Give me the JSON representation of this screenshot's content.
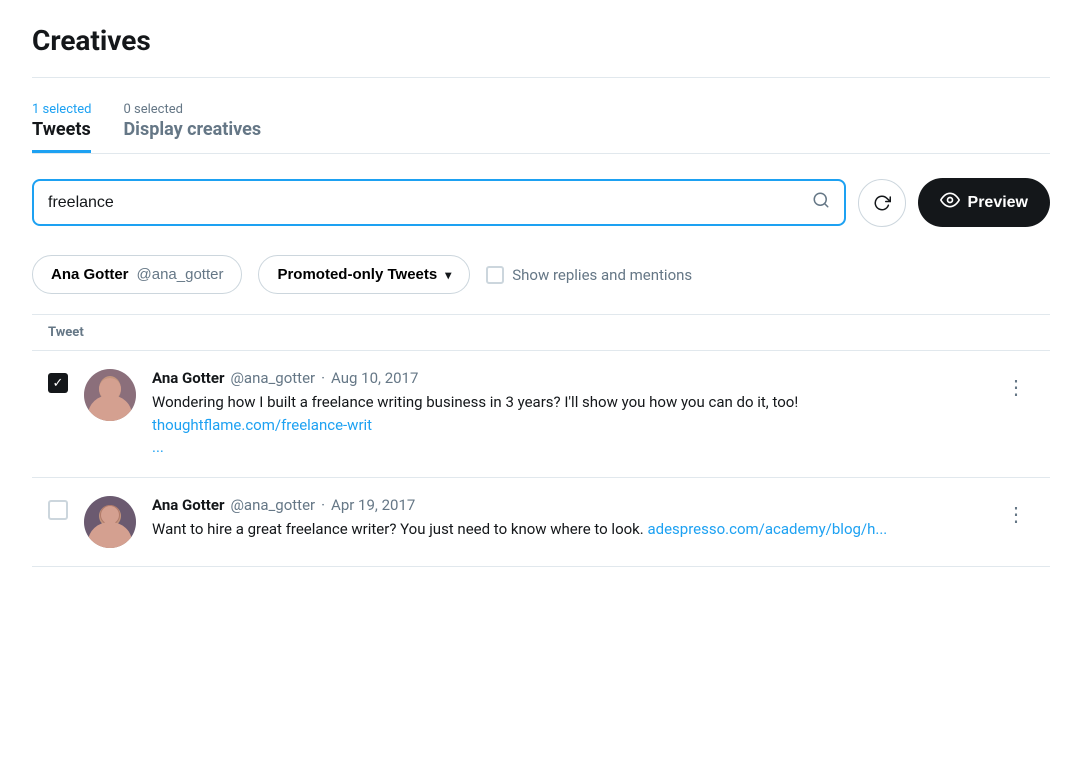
{
  "page": {
    "title": "Creatives"
  },
  "tabs": [
    {
      "id": "tweets",
      "count": "1 selected",
      "label": "Tweets",
      "active": true
    },
    {
      "id": "display-creatives",
      "count": "0 selected",
      "label": "Display creatives",
      "active": false
    }
  ],
  "search": {
    "value": "freelance",
    "placeholder": "Search tweets"
  },
  "buttons": {
    "preview": "Preview",
    "refresh_title": "Refresh"
  },
  "filters": {
    "author_name": "Ana Gotter",
    "author_handle": "@ana_gotter",
    "tweet_type": "Promoted-only Tweets",
    "show_replies": "Show replies and mentions"
  },
  "table": {
    "header": "Tweet"
  },
  "tweets": [
    {
      "id": "tweet-1",
      "checked": true,
      "author_name": "Ana Gotter",
      "author_handle": "@ana_gotter",
      "date": "Aug 10, 2017",
      "text": "Wondering how I built a freelance writing business in 3 years? I'll show you how you can do it, too!",
      "link_text": "thoughtflame.com/freelance-writ\n...",
      "link_href": "https://thoughtflame.com/freelance-writ"
    },
    {
      "id": "tweet-2",
      "checked": false,
      "author_name": "Ana Gotter",
      "author_handle": "@ana_gotter",
      "date": "Apr 19, 2017",
      "text": "Want to hire a great freelance writer? You just need to know where to look.",
      "link_text": "adespresso.com/academy/blog/h...",
      "link_href": "https://adespresso.com/academy/blog/h"
    }
  ]
}
